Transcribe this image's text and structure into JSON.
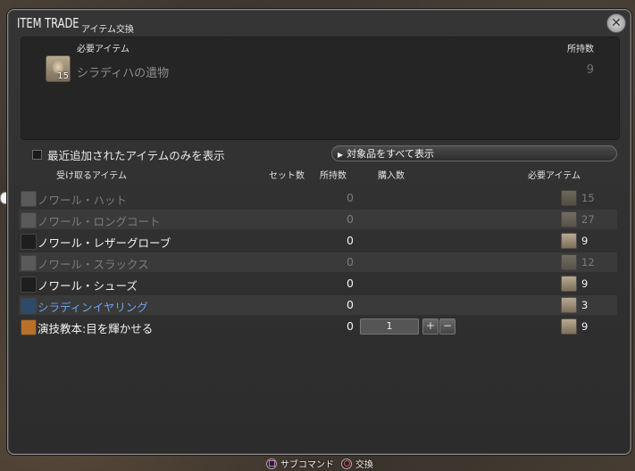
{
  "window": {
    "title": "ITEM TRADE",
    "subtitle": "アイテム交換",
    "close_icon": "close-x-icon"
  },
  "required_panel": {
    "header_item": "必要アイテム",
    "header_owned": "所持数",
    "item_name": "シラディハの遺物",
    "item_icon_qty": "15",
    "owned": "9"
  },
  "filter": {
    "checkbox_label": "最近追加されたアイテムのみを表示",
    "checked": false,
    "show_all_label": "対象品をすべて表示"
  },
  "columns": {
    "receive": "受け取るアイテム",
    "set_count": "セット数",
    "owned": "所持数",
    "purchase": "購入数",
    "required": "必要アイテム"
  },
  "rows": [
    {
      "name": "ノワール・ハット",
      "owned": "0",
      "required": "15",
      "style": "dim",
      "icon": "hat-icon",
      "icon_color": "#5a5a5a"
    },
    {
      "name": "ノワール・ロングコート",
      "owned": "0",
      "required": "27",
      "style": "dim",
      "icon": "coat-icon",
      "icon_color": "#5a5a5a"
    },
    {
      "name": "ノワール・レザーグローブ",
      "owned": "0",
      "required": "9",
      "style": "bright",
      "icon": "glove-icon",
      "icon_color": "#1e1e1e"
    },
    {
      "name": "ノワール・スラックス",
      "owned": "0",
      "required": "12",
      "style": "dim",
      "icon": "trousers-icon",
      "icon_color": "#5a5a5a"
    },
    {
      "name": "ノワール・シューズ",
      "owned": "0",
      "required": "9",
      "style": "bright",
      "icon": "shoes-icon",
      "icon_color": "#1e1e1e"
    },
    {
      "name": "シラディンイヤリング",
      "owned": "0",
      "required": "3",
      "style": "blue",
      "icon": "earring-icon",
      "icon_color": "#2e4a6a"
    },
    {
      "name": "演技教本:目を輝かせる",
      "owned": "0",
      "required": "9",
      "style": "bright",
      "icon": "book-icon",
      "icon_color": "#b8702a",
      "purchase_value": "1"
    }
  ],
  "footer": {
    "subcommand": "サブコマンド",
    "trade": "交換"
  }
}
